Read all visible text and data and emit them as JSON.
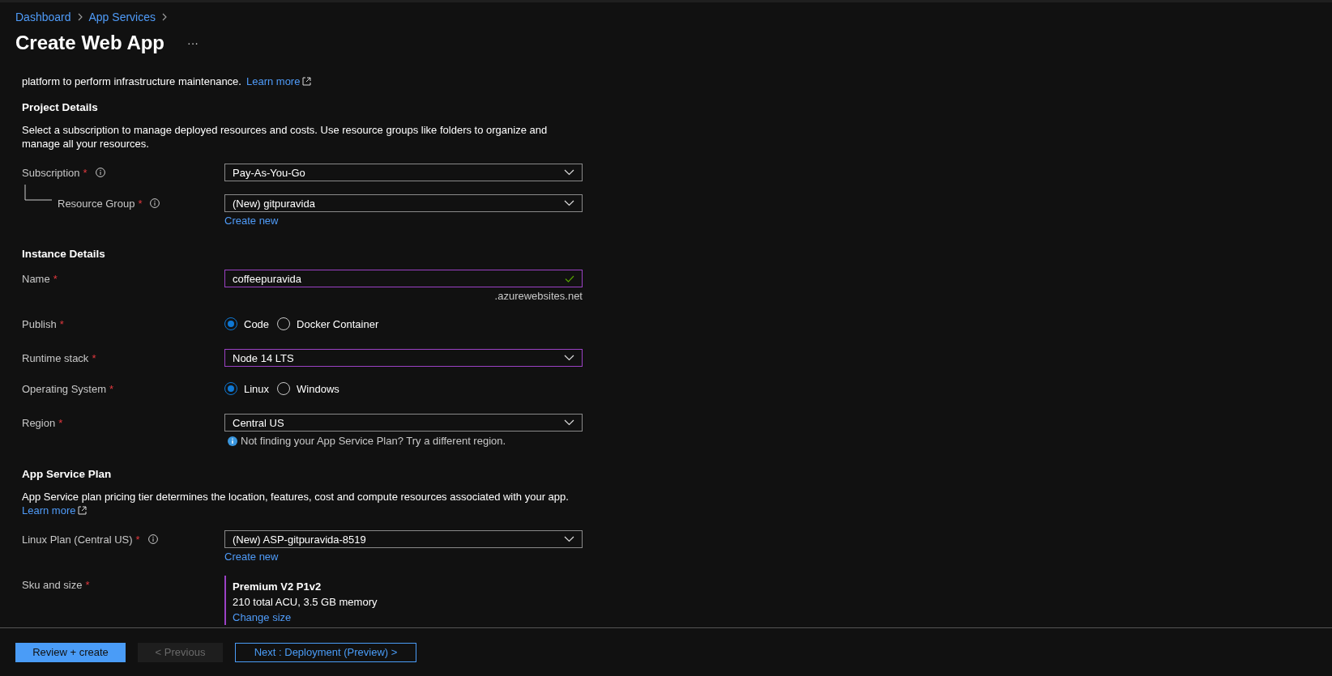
{
  "breadcrumb": [
    {
      "label": "Dashboard"
    },
    {
      "label": "App Services"
    }
  ],
  "title": "Create Web App",
  "more_button": "···",
  "intro": {
    "text": "platform to perform infrastructure maintenance.",
    "link": "Learn more"
  },
  "sections": [
    {
      "heading": "Project Details",
      "description": "Select a subscription to manage deployed resources and costs. Use resource groups like folders to organize and manage all your resources.",
      "fields": [
        {
          "kind": "select",
          "label": "Subscription",
          "required_mark": "*",
          "info": true,
          "highlighted": false,
          "value": "Pay-As-You-Go"
        },
        {
          "kind": "select",
          "label": "Resource Group",
          "required_mark": "*",
          "info": true,
          "nested": true,
          "highlighted": false,
          "value": "(New) gitpuravida",
          "link": "Create new"
        }
      ]
    },
    {
      "heading": "Instance Details",
      "fields": [
        {
          "kind": "text",
          "label": "Name",
          "required_mark": "*",
          "highlighted": true,
          "valid": true,
          "value": "coffeepuravida",
          "suffix": ".azurewebsites.net"
        },
        {
          "kind": "radio",
          "label": "Publish",
          "required_mark": "*",
          "options": [
            {
              "label": "Code",
              "selected": true
            },
            {
              "label": "Docker Container",
              "selected": false
            }
          ]
        },
        {
          "kind": "select",
          "label": "Runtime stack",
          "required_mark": "*",
          "highlighted": true,
          "value": "Node 14 LTS"
        },
        {
          "kind": "radio",
          "label": "Operating System",
          "required_mark": "*",
          "options": [
            {
              "label": "Linux",
              "selected": true
            },
            {
              "label": "Windows",
              "selected": false
            }
          ]
        },
        {
          "kind": "select",
          "label": "Region",
          "required_mark": "*",
          "highlighted": false,
          "value": "Central US",
          "note": "Not finding your App Service Plan? Try a different region."
        }
      ]
    },
    {
      "heading": "App Service Plan",
      "description": "App Service plan pricing tier determines the location, features, cost and compute resources associated with your app.",
      "description_link": "Learn more",
      "fields": [
        {
          "kind": "select",
          "label": "Linux Plan (Central US)",
          "required_mark": "*",
          "info": true,
          "highlighted": false,
          "value": "(New) ASP-gitpuravida-8519",
          "link": "Create new"
        },
        {
          "kind": "sku",
          "label": "Sku and size",
          "required_mark": "*",
          "tier": "Premium V2 P1v2",
          "detail": "210 total ACU, 3.5 GB memory",
          "link": "Change size"
        }
      ]
    }
  ],
  "footer": {
    "buttons": [
      {
        "label": "Review + create",
        "kind": "primary",
        "disabled": false
      },
      {
        "label": "< Previous",
        "kind": "secondary",
        "disabled": true
      },
      {
        "label": "Next : Deployment (Preview) >",
        "kind": "outline",
        "disabled": false
      }
    ]
  }
}
